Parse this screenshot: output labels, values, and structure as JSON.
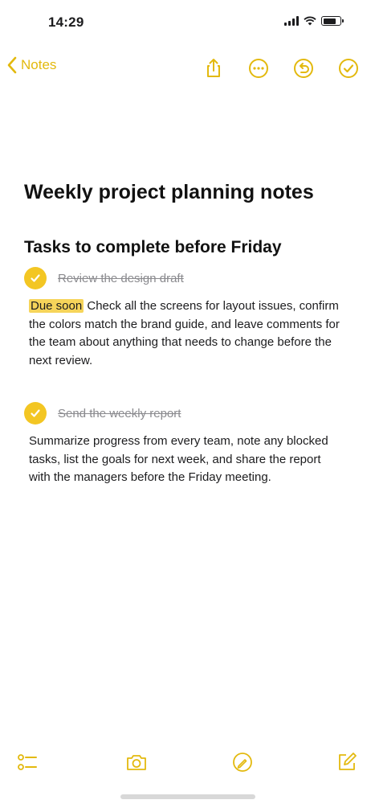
{
  "status_bar": {
    "time": "14:29",
    "battery_level": 0.8
  },
  "nav": {
    "back_label": "Notes",
    "icons": [
      "share-icon",
      "more-icon",
      "undo-icon",
      "done-icon"
    ]
  },
  "note": {
    "title": "Weekly project planning notes",
    "heading": "Tasks to complete before Friday",
    "items": [
      {
        "label": "Review the design draft",
        "done": true,
        "body_prefix": "Due soon",
        "body": " Check all the screens for layout issues, confirm the colors match the brand guide, and leave comments for the team about anything that needs to change before the next review."
      },
      {
        "label": "Send the weekly report",
        "done": true,
        "body_prefix": "",
        "body": "Summarize progress from every team, note any blocked tasks, list the goals for next week, and share the report with the managers before the Friday meeting."
      }
    ]
  },
  "toolbar": {
    "icons": [
      "checklist-icon",
      "camera-icon",
      "markup-icon",
      "compose-icon"
    ]
  },
  "colors": {
    "accent": "#e3b90e",
    "check_fill": "#f3c623",
    "highlight": "#f6d45a"
  }
}
